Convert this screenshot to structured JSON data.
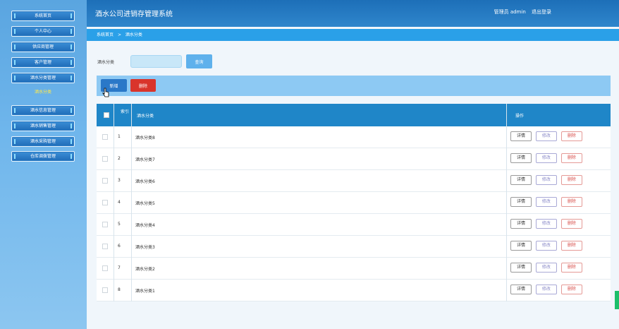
{
  "app": {
    "title": "酒水公司进销存管理系统",
    "user_label": "管理员 admin",
    "logout": "退出登录"
  },
  "sidebar": {
    "items": [
      {
        "label": "系统首页"
      },
      {
        "label": "个人中心"
      },
      {
        "label": "供应商管理"
      },
      {
        "label": "客户管理"
      },
      {
        "label": "酒水分类管理"
      },
      {
        "label": "酒水信息管理"
      },
      {
        "label": "酒水销售管理"
      },
      {
        "label": "酒水采购管理"
      },
      {
        "label": "仓库调拨管理"
      }
    ],
    "submenu": {
      "label": "酒水分类"
    }
  },
  "breadcrumb": {
    "home": "系统首页",
    "separator": ">",
    "current": "酒水分类"
  },
  "search": {
    "label": "酒水分类",
    "value": "",
    "placeholder": "",
    "button": "查询"
  },
  "actions": {
    "add": "新增",
    "delete": "删除"
  },
  "table": {
    "headers": {
      "no": "索引",
      "name": "酒水分类",
      "ops": "操作"
    },
    "rows": [
      {
        "no": "1",
        "name": "酒水分类8"
      },
      {
        "no": "2",
        "name": "酒水分类7"
      },
      {
        "no": "3",
        "name": "酒水分类6"
      },
      {
        "no": "4",
        "name": "酒水分类5"
      },
      {
        "no": "5",
        "name": "酒水分类4"
      },
      {
        "no": "6",
        "name": "酒水分类3"
      },
      {
        "no": "7",
        "name": "酒水分类2"
      },
      {
        "no": "8",
        "name": "酒水分类1"
      }
    ],
    "row_actions": {
      "detail": "详情",
      "edit": "修改",
      "delete": "删除"
    }
  },
  "colors": {
    "header_blue": "#1f86c8",
    "danger": "#d9342b",
    "primary": "#2a78c8"
  }
}
